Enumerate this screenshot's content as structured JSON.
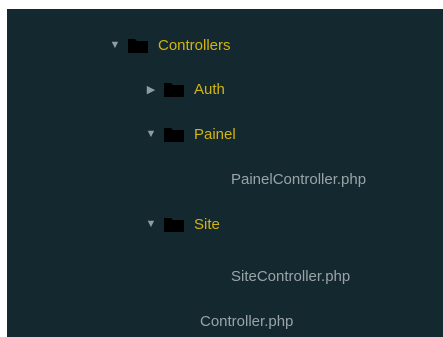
{
  "tree": {
    "controllers": {
      "label": "Controllers",
      "arrow": "▼",
      "icon": "folder-icon"
    },
    "auth": {
      "label": "Auth",
      "arrow": "▶",
      "icon": "folder-icon"
    },
    "painel": {
      "label": "Painel",
      "arrow": "▼",
      "icon": "folder-icon"
    },
    "painel_controller": {
      "label": "PainelController.php"
    },
    "site": {
      "label": "Site",
      "arrow": "▼",
      "icon": "folder-icon"
    },
    "site_controller": {
      "label": "SiteController.php"
    },
    "controller": {
      "label": "Controller.php"
    }
  },
  "colors": {
    "background": "#13282f",
    "folder_label": "#d3b410",
    "file_label": "#9aa4a8",
    "arrow": "#8f9ca1",
    "folder_icon": "#000000"
  }
}
